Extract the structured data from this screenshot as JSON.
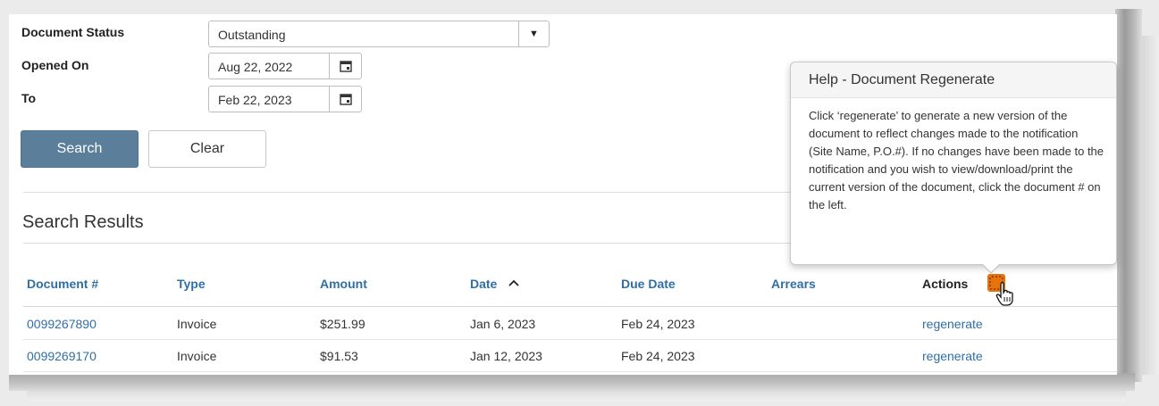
{
  "filters": {
    "status_label": "Document Status",
    "status_value": "Outstanding",
    "opened_label": "Opened On",
    "opened_value": "Aug 22, 2022",
    "to_label": "To",
    "to_value": "Feb 22, 2023"
  },
  "buttons": {
    "search": "Search",
    "clear": "Clear"
  },
  "results": {
    "heading": "Search Results",
    "columns": [
      "Document #",
      "Type",
      "Amount",
      "Date",
      "Due Date",
      "Arrears",
      "Actions"
    ],
    "rows": [
      {
        "document": "0099267890",
        "type": "Invoice",
        "amount": "$251.99",
        "date": "Jan 6, 2023",
        "due_date": "Feb 24, 2023",
        "arrears": "",
        "action": "regenerate"
      },
      {
        "document": "0099269170",
        "type": "Invoice",
        "amount": "$91.53",
        "date": "Jan 12, 2023",
        "due_date": "Feb 24, 2023",
        "arrears": "",
        "action": "regenerate"
      }
    ]
  },
  "help": {
    "title": "Help - Document Regenerate",
    "body": "Click ‘regenerate’ to generate a new version of the document to reflect changes made to the notification (Site Name, P.O.#). If no changes have been made to the notification and you wish to view/download/print the current version of the document, click the document # on the left."
  },
  "icons": {
    "sort": "chevron-up-icon",
    "help": "help-icon",
    "cursor": "hand-pointer-icon",
    "calendar": "calendar-icon",
    "dropdown": "caret-down-icon"
  },
  "colors": {
    "primary_button": "#5b7f9b",
    "link": "#2f6fa6",
    "help_icon": "#e8720c"
  }
}
